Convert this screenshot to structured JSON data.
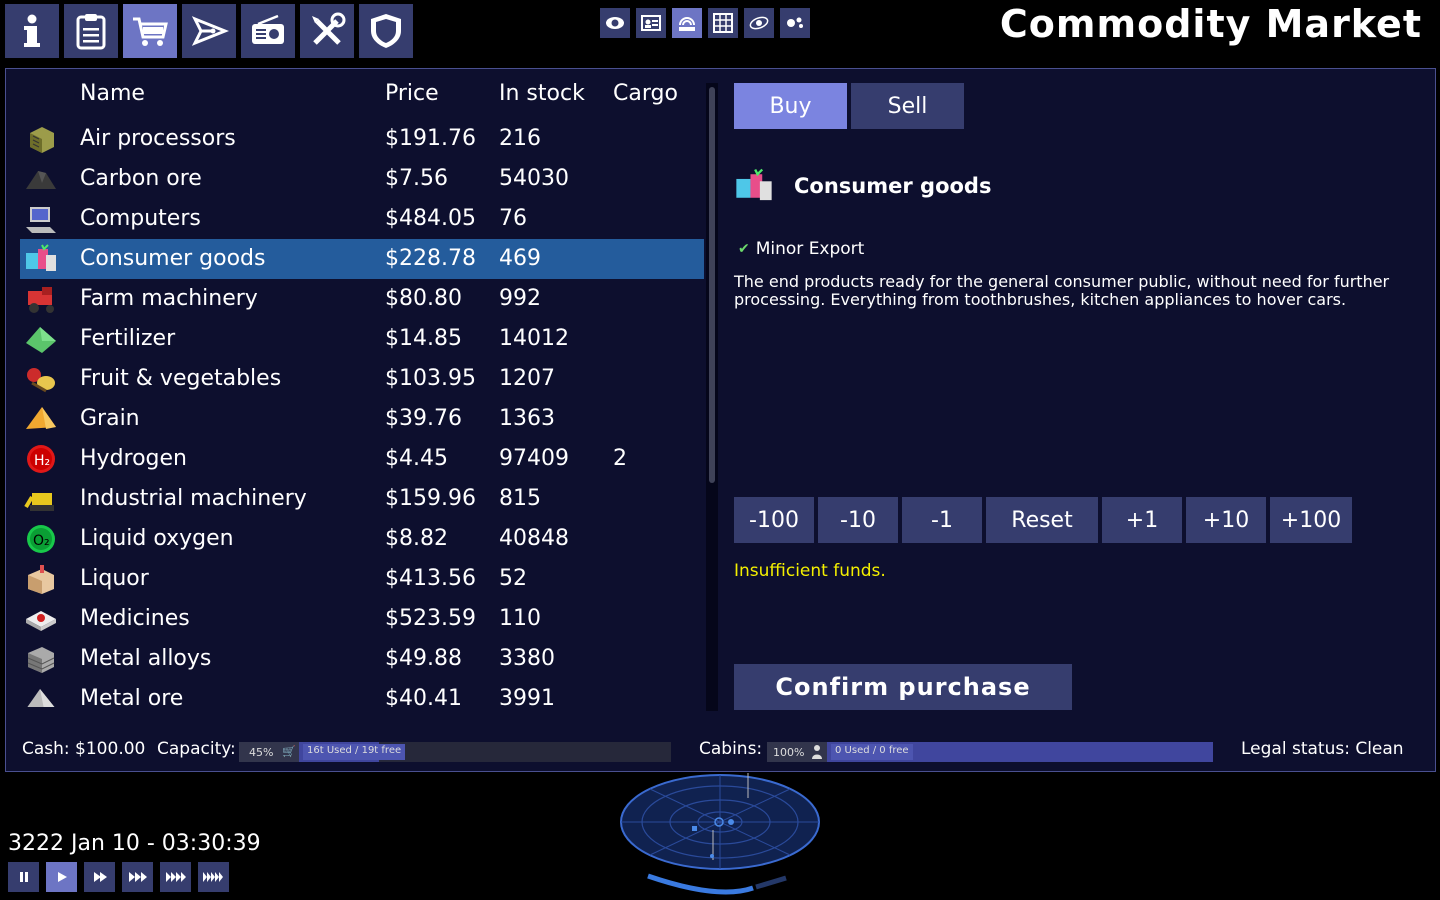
{
  "header": {
    "title": "Commodity Market"
  },
  "toolbar": {
    "buttons": [
      "info-icon",
      "clipboard-icon",
      "cart-icon",
      "ship-icon",
      "radio-icon",
      "tools-icon",
      "shield-icon"
    ],
    "active": "cart-icon"
  },
  "views": {
    "buttons": [
      "eye-icon",
      "id-card-icon",
      "satellite-icon",
      "grid-icon",
      "orbit-icon",
      "bubbles-icon"
    ]
  },
  "market": {
    "headers": {
      "name": "Name",
      "price": "Price",
      "stock": "In stock",
      "cargo": "Cargo"
    },
    "rows": [
      {
        "name": "Air processors",
        "price": "$191.76",
        "stock": "216",
        "cargo": ""
      },
      {
        "name": "Carbon ore",
        "price": "$7.56",
        "stock": "54030",
        "cargo": ""
      },
      {
        "name": "Computers",
        "price": "$484.05",
        "stock": "76",
        "cargo": ""
      },
      {
        "name": "Consumer goods",
        "price": "$228.78",
        "stock": "469",
        "cargo": ""
      },
      {
        "name": "Farm machinery",
        "price": "$80.80",
        "stock": "992",
        "cargo": ""
      },
      {
        "name": "Fertilizer",
        "price": "$14.85",
        "stock": "14012",
        "cargo": ""
      },
      {
        "name": "Fruit & vegetables",
        "price": "$103.95",
        "stock": "1207",
        "cargo": ""
      },
      {
        "name": "Grain",
        "price": "$39.76",
        "stock": "1363",
        "cargo": ""
      },
      {
        "name": "Hydrogen",
        "price": "$4.45",
        "stock": "97409",
        "cargo": "2"
      },
      {
        "name": "Industrial machinery",
        "price": "$159.96",
        "stock": "815",
        "cargo": ""
      },
      {
        "name": "Liquid oxygen",
        "price": "$8.82",
        "stock": "40848",
        "cargo": ""
      },
      {
        "name": "Liquor",
        "price": "$413.56",
        "stock": "52",
        "cargo": ""
      },
      {
        "name": "Medicines",
        "price": "$523.59",
        "stock": "110",
        "cargo": ""
      },
      {
        "name": "Metal alloys",
        "price": "$49.88",
        "stock": "3380",
        "cargo": ""
      },
      {
        "name": "Metal ore",
        "price": "$40.41",
        "stock": "3991",
        "cargo": ""
      }
    ],
    "selected_index": 3
  },
  "detail": {
    "tabs": [
      "Buy",
      "Sell"
    ],
    "active_tab": "Buy",
    "item_name": "Consumer goods",
    "export_status": "Minor Export",
    "description": "The end products ready for the general consumer public, without need for further processing. Everything from toothbrushes, kitchen appliances to hover cars.",
    "qty_buttons": [
      "-100",
      "-10",
      "-1",
      "Reset",
      "+1",
      "+10",
      "+100"
    ],
    "warning": "Insufficient funds.",
    "confirm_label": "Confirm purchase"
  },
  "status": {
    "cash": "Cash: $100.00",
    "capacity_label": "Capacity:",
    "capacity_pct": "45%",
    "capacity_used": "16t Used / 19t free",
    "capacity_fill": 0.45,
    "cabins_label": "Cabins:",
    "cabins_pct": "100%",
    "cabins_used": "0 Used / 0 free",
    "cabins_fill": 1.0,
    "legal": "Legal status: Clean"
  },
  "time": {
    "datetime": "3222 Jan 10 - 03:30:39",
    "speed_buttons": [
      "pause-icon",
      "play-icon",
      "fast-1-icon",
      "fast-2-icon",
      "fast-3-icon",
      "fast-4-icon"
    ],
    "active_speed": "play-icon"
  },
  "colors": {
    "accent": "#6d75c4",
    "button": "#363d6e",
    "selected_row": "#245c9c",
    "panel": "#0d0f2e",
    "warning": "#f4f000"
  }
}
